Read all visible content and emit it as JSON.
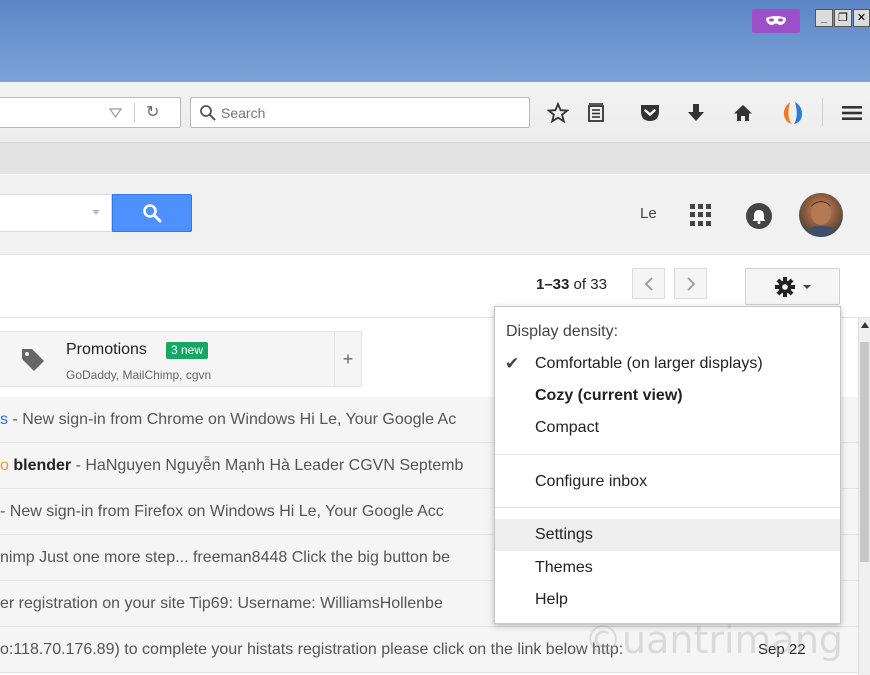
{
  "window": {
    "controls": [
      "_",
      "❐",
      "✕"
    ],
    "accent_mask_color": "#9b4fc9"
  },
  "browser": {
    "search_placeholder": "Search",
    "toolbar_icons": [
      "star-icon",
      "reading-list-icon",
      "pocket-icon",
      "download-icon",
      "home-icon",
      "sync-icon",
      "menu-icon"
    ]
  },
  "gmail": {
    "user_name": "Le",
    "pager": {
      "range": "1–33",
      "of_label": "of 33"
    },
    "tabs": {
      "promotions": {
        "title": "Promotions",
        "badge": "3 new",
        "senders": "GoDaddy, MailChimp, cgvn"
      },
      "add_tab": "+"
    },
    "emails": [
      {
        "lead": "s",
        "subject": " - New sign-in from Chrome on Windows Hi Le, Your Google Ac",
        "date": ""
      },
      {
        "lead": "o",
        "bold": "blender",
        "subject": " - HaNguyen Nguyễn Mạnh Hà Leader CGVN Septemb",
        "date": ""
      },
      {
        "lead": "",
        "subject": "- New sign-in from Firefox on Windows Hi Le, Your Google Acc",
        "date": ""
      },
      {
        "lead": "",
        "subject": "nimp Just one more step... freeman8448 Click the big button be",
        "date": ""
      },
      {
        "lead": "",
        "subject": "er registration on your site Tip69: Username: WilliamsHollenbe",
        "date": ""
      },
      {
        "lead": "",
        "subject": "o:118.70.176.89) to complete your histats registration please click on the link below http:",
        "date": "Sep 22"
      }
    ],
    "settings_menu": {
      "header": "Display density:",
      "items": [
        {
          "label": "Comfortable (on larger displays)",
          "checked": true
        },
        {
          "label": "Cozy (current view)",
          "bold": true
        },
        {
          "label": "Compact"
        },
        {
          "label": "Configure inbox"
        },
        {
          "label": "Settings",
          "highlighted": true
        },
        {
          "label": "Themes"
        },
        {
          "label": "Help"
        }
      ]
    }
  },
  "watermark": "©uantrimang",
  "colors": {
    "search_button": "#4d90fe",
    "new_badge": "#16a765",
    "titlebar": "#6f98d2"
  }
}
